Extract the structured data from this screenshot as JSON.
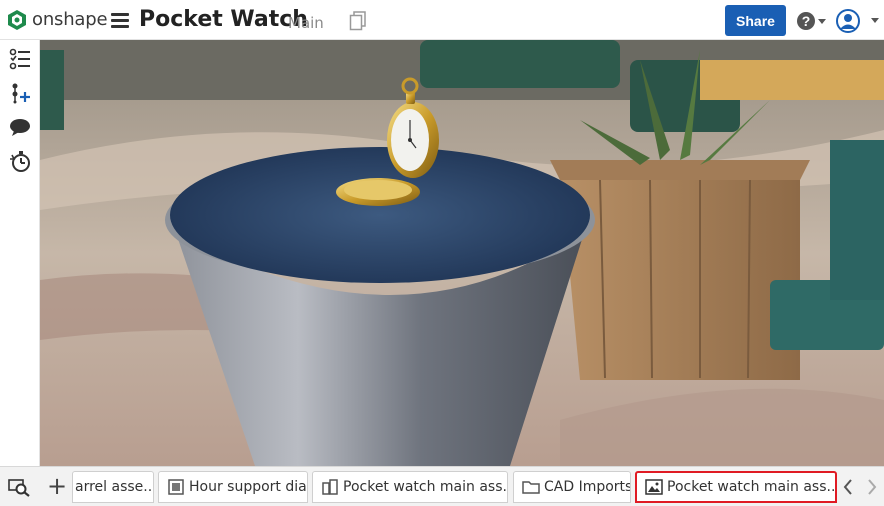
{
  "header": {
    "brand": "onshape",
    "document_title": "Pocket Watch",
    "branch": "Main",
    "share_label": "Share"
  },
  "bottom_tabs": [
    {
      "label": "arrel asse...",
      "icon": "assembly-icon"
    },
    {
      "label": "Hour support dial",
      "icon": "part-studio-icon"
    },
    {
      "label": "Pocket watch main ass...",
      "icon": "assembly-icon"
    },
    {
      "label": "CAD Imports",
      "icon": "folder-icon"
    },
    {
      "label": "Pocket watch main ass...",
      "icon": "render-image-icon",
      "active": true
    }
  ],
  "colors": {
    "accent": "#1a5fb4",
    "active_tab_border": "#e01b24"
  },
  "left_toolbar": [
    "feature-list-icon",
    "insert-part-icon",
    "comments-icon",
    "history-icon"
  ]
}
